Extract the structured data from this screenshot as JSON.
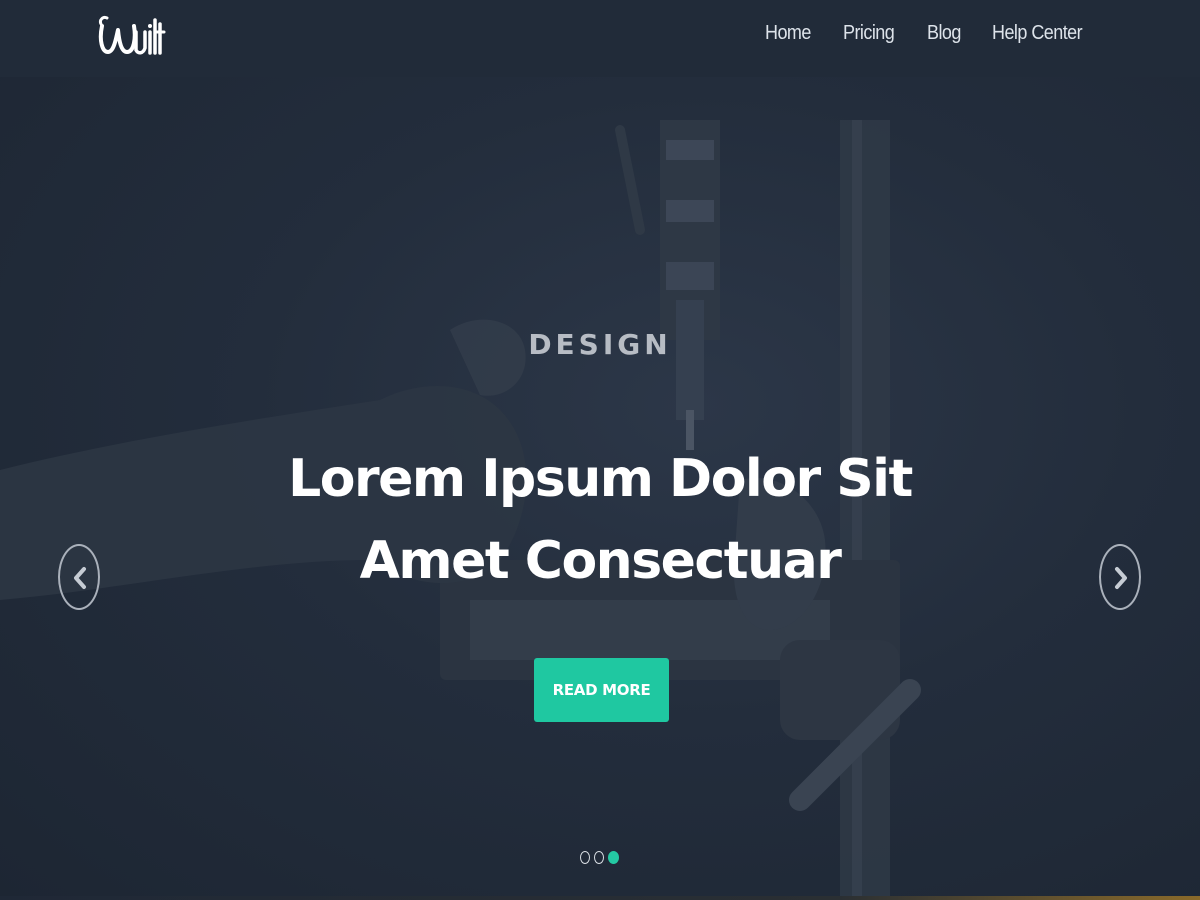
{
  "brand": {
    "logo_text": "Built",
    "logo_icon": "wuilt-logo"
  },
  "nav": {
    "items": [
      {
        "label": "Home"
      },
      {
        "label": "Pricing"
      },
      {
        "label": "Blog"
      },
      {
        "label": "Help Center"
      }
    ]
  },
  "slide": {
    "eyebrow": "DESIGN",
    "title": "Lorem Ipsum Dolor Sit Amet Consectuar",
    "button_label": "READ MORE",
    "accent_color": "#1fc8a1"
  },
  "carousel": {
    "prev_icon": "chevron-left-icon",
    "next_icon": "chevron-right-icon",
    "slide_count": 3,
    "active_index": 2
  }
}
